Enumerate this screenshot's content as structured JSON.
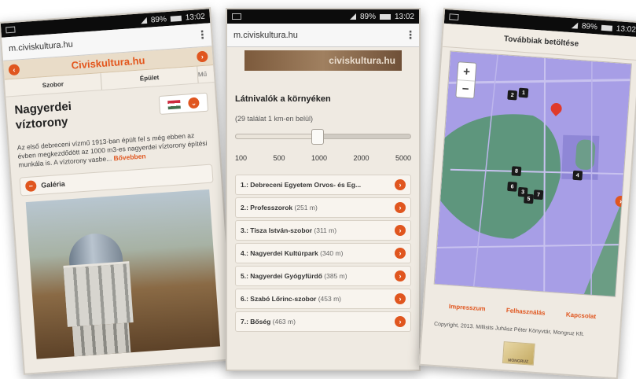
{
  "colors": {
    "accent": "#e0561f",
    "map": "#a79ee6",
    "park": "#5e967d",
    "mapBorder": "#c3bdb4"
  },
  "statusbar": {
    "battery": "89%",
    "time": "13:02"
  },
  "phone1": {
    "url": "m.civiskultura.hu",
    "brand": "Civiskultura.hu",
    "nav": [
      "Szobor",
      "Épület",
      "Mű"
    ],
    "title": "Nagyerdei víztorony",
    "description": "Az első debreceni vízmű 1913-ban épült fel s még ebben az évben megkezdődött az 1000 m3-es nagyerdei víztorony építési munkála is. A víztorony vasbe...",
    "more": "Bővebben",
    "gallery": "Galéria"
  },
  "phone2": {
    "url": "m.civiskultura.hu",
    "banner": "civiskultura.hu",
    "heading": "Látnivalók a környéken",
    "hits": "(29 találat 1 km-en belül)",
    "slider": {
      "ticks": [
        "100",
        "500",
        "1000",
        "2000",
        "5000"
      ],
      "level": 0.47
    },
    "items": [
      {
        "name": "1.: Debreceni Egyetem Orvos- és Eg...",
        "dist": ""
      },
      {
        "name": "2.: Professzorok",
        "dist": "(251 m)"
      },
      {
        "name": "3.: Tisza István-szobor",
        "dist": "(311 m)"
      },
      {
        "name": "4.: Nagyerdei Kultúrpark",
        "dist": "(340 m)"
      },
      {
        "name": "5.: Nagyerdei Gyógyfürdő",
        "dist": "(385 m)"
      },
      {
        "name": "6.: Szabó Lőrinc-szobor",
        "dist": "(453 m)"
      },
      {
        "name": "7.: Bőség",
        "dist": "(463 m)"
      }
    ]
  },
  "phone3": {
    "header": "Továbbiak betöltése",
    "zoom_in": "+",
    "zoom_out": "−",
    "markers": [
      "2",
      "1",
      "8",
      "6",
      "3",
      "5",
      "7",
      "4"
    ],
    "links": [
      "Impresszum",
      "Felhasználás",
      "Kapcsolat"
    ],
    "copyright": "Copyright, 2013. Millisits Juhász Péter Könyvtár, Mongruz Kft.",
    "logo": "MONGRUZ"
  }
}
